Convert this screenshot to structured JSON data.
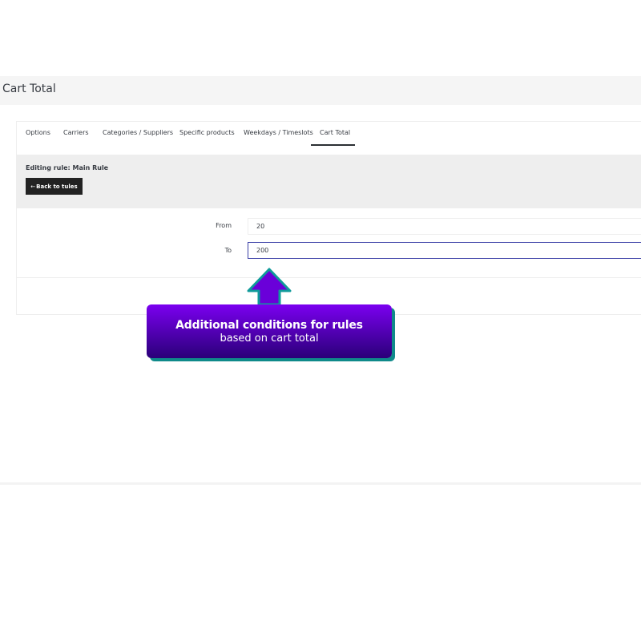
{
  "header": {
    "title": "Cart Total"
  },
  "tabs": [
    {
      "label": "Options"
    },
    {
      "label": "Carriers"
    },
    {
      "label": "Categories / Suppliers"
    },
    {
      "label": "Specific products"
    },
    {
      "label": "Weekdays / Timeslots"
    },
    {
      "label": "Cart Total"
    }
  ],
  "active_tab": "Cart Total",
  "editing": {
    "title": "Editing rule: Main Rule",
    "back_arrow": "←",
    "back_label": "Back to tules"
  },
  "form": {
    "from_label": "From",
    "from_value": "20",
    "to_label": "To",
    "to_value": "200"
  },
  "callout": {
    "line1": "Additional conditions for rules",
    "line2": "based on cart total"
  },
  "colors": {
    "callout_top": "#7b00f0",
    "callout_bottom": "#2a0078",
    "callout_shadow": "#0f8a8a",
    "arrow_fill": "#6a00d9",
    "arrow_stroke": "#0f9a9a",
    "button_bg": "#222222",
    "focus_border": "#3a3fa6"
  }
}
